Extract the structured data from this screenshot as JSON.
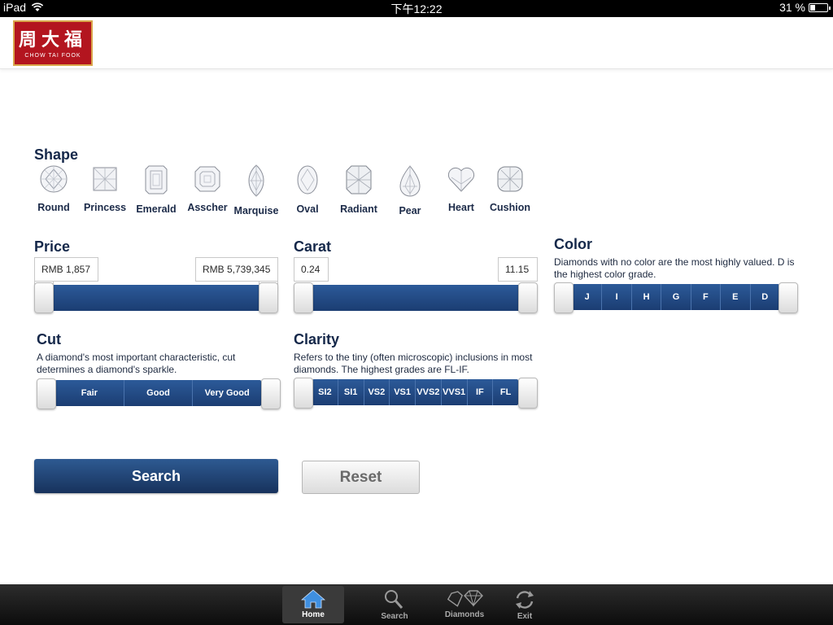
{
  "status_bar": {
    "device": "iPad",
    "time": "下午12:22",
    "battery": "31 %",
    "battery_level": 0.31
  },
  "header": {
    "logo_cn": "周大福",
    "logo_en": "CHOW TAI FOOK"
  },
  "shape": {
    "title": "Shape",
    "items": [
      "Round",
      "Princess",
      "Emerald",
      "Asscher",
      "Marquise",
      "Oval",
      "Radiant",
      "Pear",
      "Heart",
      "Cushion"
    ]
  },
  "price": {
    "title": "Price",
    "min": "RMB 1,857",
    "max": "RMB 5,739,345"
  },
  "carat": {
    "title": "Carat",
    "min": "0.24",
    "max": "11.15"
  },
  "color": {
    "title": "Color",
    "description": "Diamonds with no color are the most highly valued. D is the highest color grade.",
    "grades": [
      "J",
      "I",
      "H",
      "G",
      "F",
      "E",
      "D"
    ]
  },
  "cut": {
    "title": "Cut",
    "description": "A diamond's most important characteristic, cut determines a diamond's sparkle.",
    "grades": [
      "Fair",
      "Good",
      "Very Good"
    ]
  },
  "clarity": {
    "title": "Clarity",
    "description": "Refers to the tiny (often microscopic) inclusions in most diamonds. The highest grades are FL-IF.",
    "grades": [
      "SI2",
      "SI1",
      "VS2",
      "VS1",
      "VVS2",
      "VVS1",
      "IF",
      "FL"
    ]
  },
  "actions": {
    "search_label": "Search",
    "reset_label": "Reset"
  },
  "tabbar": {
    "items": [
      {
        "label": "Home",
        "icon": "home-icon"
      },
      {
        "label": "Search",
        "icon": "magnifier-icon"
      },
      {
        "label": "Diamonds",
        "icon": "diamonds-icon"
      },
      {
        "label": "Exit",
        "icon": "refresh-icon"
      }
    ]
  },
  "colors": {
    "brand_red": "#b3151f",
    "slider_blue": "#1f4a86",
    "search_blue": "#1f3f6e"
  }
}
